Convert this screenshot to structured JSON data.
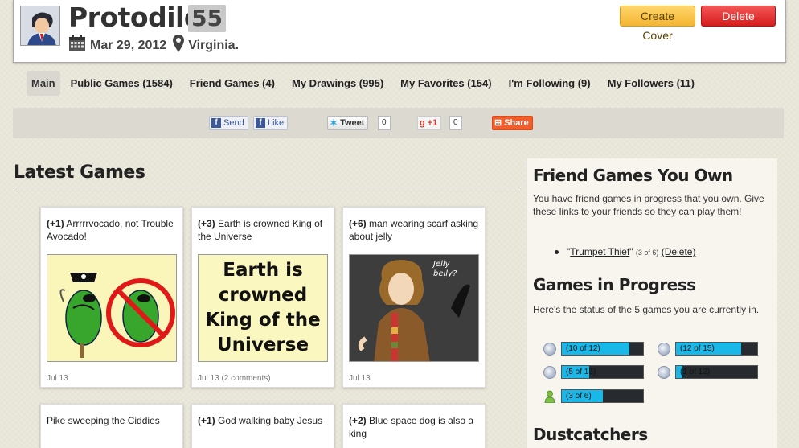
{
  "profile": {
    "username": "Protodile",
    "score": "55",
    "date": "Mar 29, 2012",
    "location": "Virginia.",
    "create_cover_label": "Create Cover",
    "delete_cover_label": "Delete Cover"
  },
  "nav": {
    "items": [
      {
        "label": "Main"
      },
      {
        "label": "Public Games (1584)"
      },
      {
        "label": "Friend Games (4)"
      },
      {
        "label": "My Drawings (995)"
      },
      {
        "label": "My Favorites (154)"
      },
      {
        "label": "I'm Following (9)"
      },
      {
        "label": "My Followers (11)"
      }
    ]
  },
  "share": {
    "send": "Send",
    "like": "Like",
    "tweet": "Tweet",
    "tweet_count": "0",
    "gplus": "+1",
    "gplus_count": "0",
    "share": "Share"
  },
  "latest": {
    "title": "Latest Games",
    "cards": [
      {
        "score": "(+1)",
        "caption": " Arrrrrvocado, not Trouble Avocado!",
        "date": "Jul 13"
      },
      {
        "score": "(+3)",
        "caption": " Earth is crowned King of the Universe",
        "thumb_text": "Earth is crowned King of the Universe",
        "date": "Jul 13 (2 comments)"
      },
      {
        "score": "(+6)",
        "caption": " man wearing scarf asking about jelly",
        "thumb_text": "Jelly belly?",
        "date": "Jul 13"
      },
      {
        "score": "",
        "caption": "Pike sweeping the Ciddies"
      },
      {
        "score": "(+1)",
        "caption": " God walking baby Jesus"
      },
      {
        "score": "(+2)",
        "caption": " Blue space dog is also a king"
      }
    ]
  },
  "sidebar": {
    "friend_title": "Friend Games You Own",
    "friend_text": "You have friend games in progress that you own. Give these links to your friends so they can play them!",
    "friend_game": {
      "quote_open": "\"",
      "name": "Trumpet Thief",
      "quote_close": "\"",
      "progress": "(3 of 6)",
      "delete": "(Delete)"
    },
    "progress_title": "Games in Progress",
    "progress_text": "Here's the status of the 5 games you are currently in.",
    "progress": [
      {
        "label": "(10 of 12)",
        "fraction": 0.8333,
        "icon": "globe-icon"
      },
      {
        "label": "(12 of 15)",
        "fraction": 0.8,
        "icon": "globe-icon"
      },
      {
        "label": "(5 of 15)",
        "fraction": 0.3333,
        "icon": "globe-icon"
      },
      {
        "label": "(1 of 12)",
        "fraction": 0.0833,
        "icon": "globe-icon"
      },
      {
        "label": "(3 of 6)",
        "fraction": 0.5,
        "icon": "person-icon"
      }
    ],
    "dust_title": "Dustcatchers"
  }
}
